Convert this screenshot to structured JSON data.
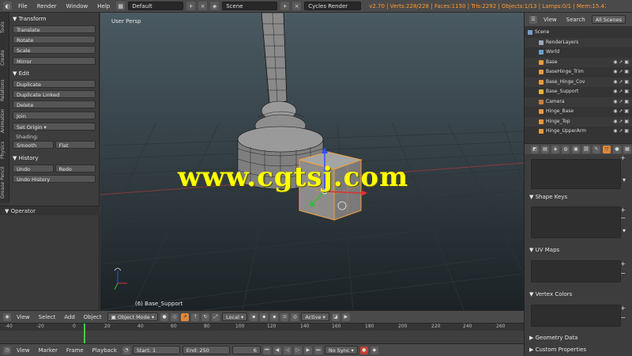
{
  "topbar": {
    "menus": [
      "File",
      "Render",
      "Window",
      "Help"
    ],
    "layout": "Default",
    "scene": "Scene",
    "engine": "Cycles Render",
    "stats": "v2.70 | Verts:228/228 | Faces:1150 | Tris:2292 | Objects:1/13 | Lamps:0/1 | Mem:15.41M | Base_Supp"
  },
  "vtabs": [
    "Tools",
    "Create",
    "Relations",
    "Animation",
    "Physics",
    "Grease Pencil"
  ],
  "toolshelf": {
    "transform_title": "Transform",
    "transform": [
      "Translate",
      "Rotate",
      "Scale"
    ],
    "mirror": "Mirror",
    "edit_title": "Edit",
    "edit": [
      "Duplicate",
      "Duplicate Linked",
      "Delete"
    ],
    "join": "Join",
    "set_origin": "Set Origin",
    "shading_label": "Shading:",
    "smooth": "Smooth",
    "flat": "Flat",
    "history_title": "History",
    "undo": "Undo",
    "redo": "Redo",
    "undo_history": "Undo History",
    "operator": "Operator"
  },
  "viewport": {
    "label": "User Persp",
    "object_info": "(6) Base_Support",
    "watermark": "www.cgtsj.com"
  },
  "vp_header": {
    "menus": [
      "View",
      "Select",
      "Add",
      "Object"
    ],
    "mode": "Object Mode",
    "pivot": "Local",
    "layer": "Active"
  },
  "timeline": {
    "ticks": [
      "-40",
      "-20",
      "0",
      "20",
      "40",
      "60",
      "80",
      "100",
      "120",
      "140",
      "160",
      "180",
      "200",
      "220",
      "240",
      "260"
    ],
    "menus": [
      "View",
      "Marker",
      "Frame",
      "Playback"
    ],
    "start": "Start:",
    "start_val": "1",
    "end": "End:",
    "end_val": "250",
    "current": "6",
    "sync": "No Sync"
  },
  "outliner": {
    "header": [
      "View",
      "Search",
      "All Scenes"
    ],
    "rows": [
      {
        "name": "Scene",
        "indent": 0,
        "color": "#7a9ec8"
      },
      {
        "name": "RenderLayers",
        "indent": 1,
        "color": "#9aa8b8"
      },
      {
        "name": "World",
        "indent": 1,
        "color": "#6aa0d0"
      },
      {
        "name": "Base",
        "indent": 1,
        "color": "#e89a40"
      },
      {
        "name": "BaseHinge_Trim",
        "indent": 1,
        "color": "#e89a40"
      },
      {
        "name": "Base_Hinge_Cov",
        "indent": 1,
        "color": "#e89a40"
      },
      {
        "name": "Base_Support",
        "indent": 1,
        "color": "#e8b040"
      },
      {
        "name": "Camera",
        "indent": 1,
        "color": "#c88040"
      },
      {
        "name": "Hinge_Base",
        "indent": 1,
        "color": "#e89a40"
      },
      {
        "name": "Hinge_Top",
        "indent": 1,
        "color": "#e89a40"
      },
      {
        "name": "Hinge_UpperArm",
        "indent": 1,
        "color": "#e89a40"
      }
    ]
  },
  "properties": {
    "sections": [
      "Shape Keys",
      "UV Maps",
      "Vertex Colors"
    ],
    "footer": [
      "Geometry Data",
      "Custom Properties"
    ]
  }
}
